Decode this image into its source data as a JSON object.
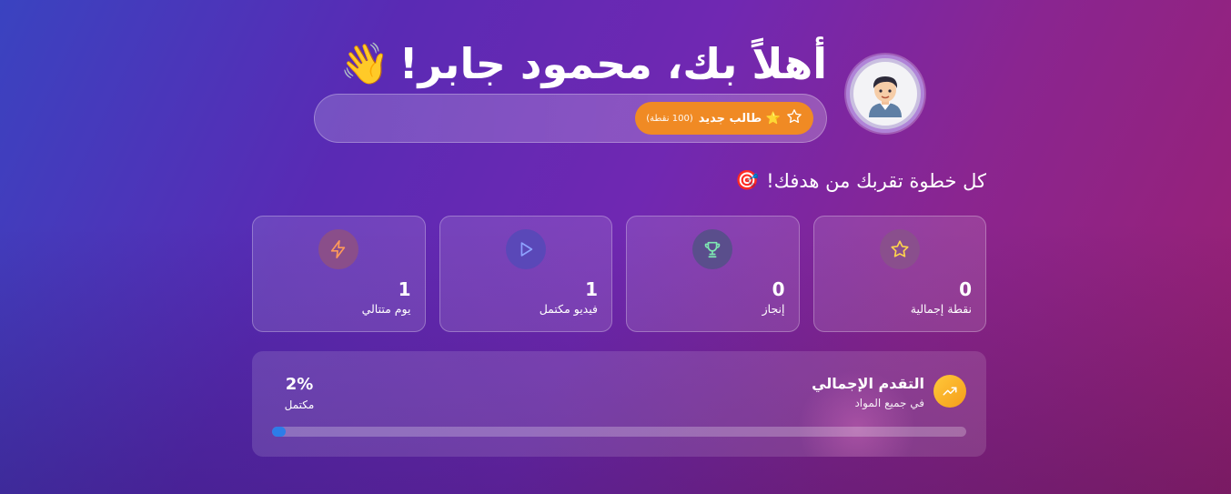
{
  "header": {
    "greeting": "أهلاً بك، محمود جابر!",
    "wave_emoji": "👋",
    "avatar_icon": "avatar-boy",
    "badge": {
      "star_icon": "star-outline",
      "title": "⭐ طالب جديد",
      "points": "(100 نقطة)"
    }
  },
  "tagline": {
    "text": "كل خطوة تقربك من هدفك!",
    "emoji": "🎯"
  },
  "stats": [
    {
      "icon": "star-icon",
      "value": "0",
      "label": "نقطة إجمالية",
      "icon_color": "#ffd34d",
      "icon_bg": "#8a4f8d"
    },
    {
      "icon": "trophy-icon",
      "value": "0",
      "label": "إنجاز",
      "icon_color": "#7ee8b2",
      "icon_bg": "#5a4e8c"
    },
    {
      "icon": "play-icon",
      "value": "1",
      "label": "فيديو مكتمل",
      "icon_color": "#8ea2ff",
      "icon_bg": "#5a48b8"
    },
    {
      "icon": "bolt-icon",
      "value": "1",
      "label": "يوم متتالي",
      "icon_color": "#ff9a5a",
      "icon_bg": "#8a4e8a"
    }
  ],
  "progress": {
    "icon": "trending-up-icon",
    "title": "التقدم الإجمالي",
    "subtitle": "في جميع المواد",
    "percent_label": "2%",
    "status_label": "مكتمل",
    "fraction": 0.02,
    "bar_color": "#2d7de8"
  }
}
